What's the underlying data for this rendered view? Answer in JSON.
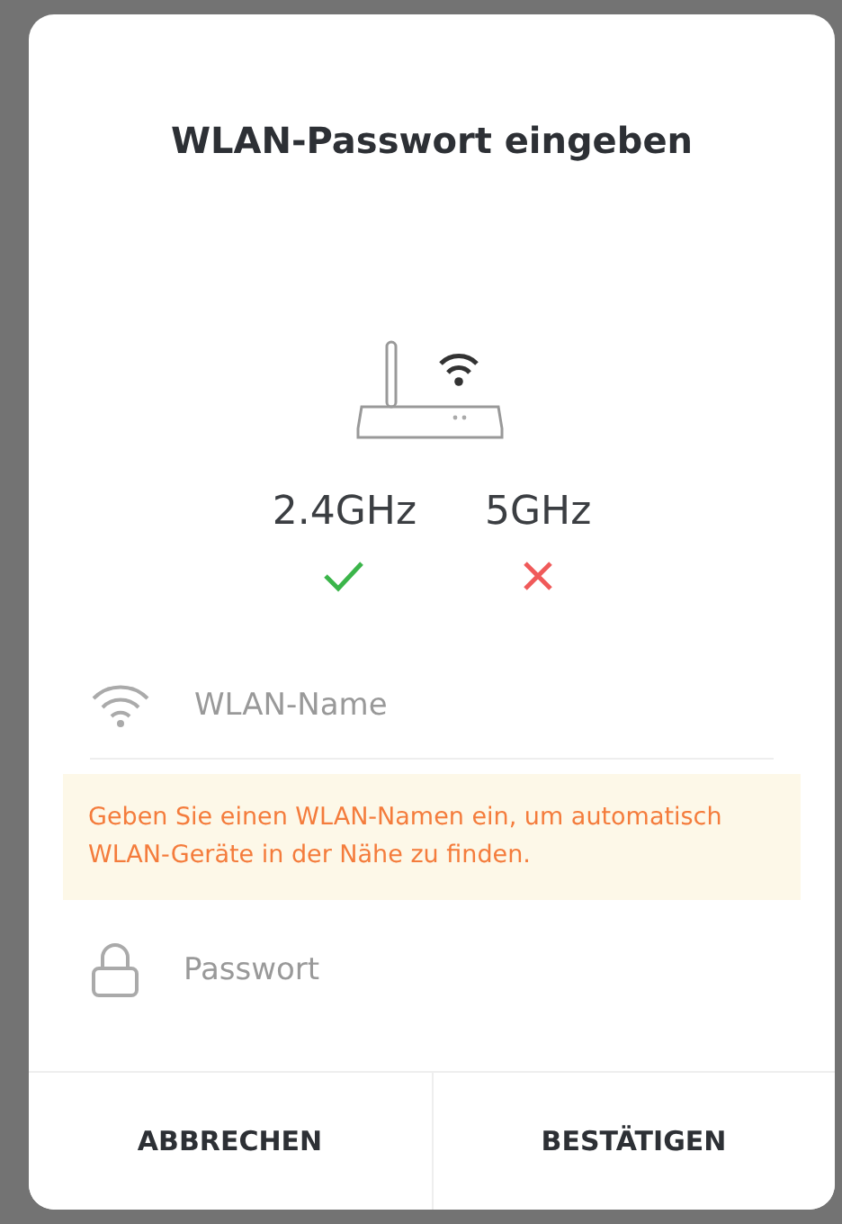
{
  "dialog": {
    "title": "WLAN-Passwort eingeben",
    "bands": [
      {
        "label": "2.4GHz",
        "supported": true
      },
      {
        "label": "5GHz",
        "supported": false
      }
    ],
    "ssid_field": {
      "placeholder": "WLAN-Name"
    },
    "hint": "Geben Sie einen WLAN-Namen ein, um automatisch WLAN-Geräte in der Nähe zu finden.",
    "password_field": {
      "placeholder": "Passwort"
    },
    "buttons": [
      "ABBRECHEN",
      "BESTÄTIGEN"
    ]
  }
}
